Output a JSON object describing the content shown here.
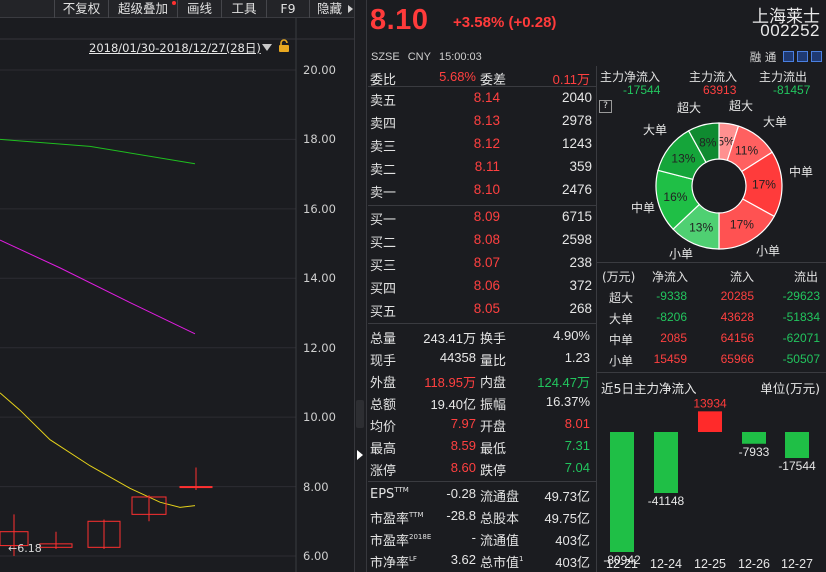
{
  "toolbar": {
    "items": [
      {
        "label": "不复权",
        "dot": false,
        "arrow": false
      },
      {
        "label": "超级叠加",
        "dot": true,
        "arrow": false
      },
      {
        "label": "画线",
        "dot": false,
        "arrow": false
      },
      {
        "label": "工具",
        "dot": false,
        "arrow": false
      },
      {
        "label": "F9",
        "dot": false,
        "arrow": false
      },
      {
        "label": "隐藏",
        "dot": false,
        "arrow": true
      }
    ]
  },
  "chart": {
    "date_range": "2018/01/30-2018/12/27(28日)",
    "y_ticks": [
      "20.00",
      "18.00",
      "16.00",
      "14.00",
      "12.00",
      "10.00",
      "8.00",
      "6.00"
    ],
    "price_marker": "←6.18",
    "colors": {
      "ma_green": "#1fbf1f",
      "ma_magenta": "#e01ce0",
      "ma_yellow": "#e6d21a",
      "candle_up": "#ff3030"
    }
  },
  "quote": {
    "price": "8.10",
    "change": "+3.58% (+0.28)",
    "name": "上海莱士",
    "code": "002252",
    "exchange": "SZSE",
    "currency": "CNY",
    "time": "15:00:03",
    "badges": "融 通"
  },
  "orderbook": {
    "weibi": {
      "label": "委比",
      "value": "5.68%"
    },
    "weicha": {
      "label": "委差",
      "value": "0.11万"
    },
    "asks": [
      {
        "label": "卖五",
        "price": "8.14",
        "vol": "2040"
      },
      {
        "label": "卖四",
        "price": "8.13",
        "vol": "2978"
      },
      {
        "label": "卖三",
        "price": "8.12",
        "vol": "1243"
      },
      {
        "label": "卖二",
        "price": "8.11",
        "vol": "359"
      },
      {
        "label": "卖一",
        "price": "8.10",
        "vol": "2476"
      }
    ],
    "bids": [
      {
        "label": "买一",
        "price": "8.09",
        "vol": "6715"
      },
      {
        "label": "买二",
        "price": "8.08",
        "vol": "2598"
      },
      {
        "label": "买三",
        "price": "8.07",
        "vol": "238"
      },
      {
        "label": "买四",
        "price": "8.06",
        "vol": "372"
      },
      {
        "label": "买五",
        "price": "8.05",
        "vol": "268"
      }
    ],
    "stats": [
      {
        "k1": "总量",
        "v1": "243.41万",
        "c1": "white",
        "k2": "换手",
        "v2": "4.90%",
        "c2": "white"
      },
      {
        "k1": "现手",
        "v1": "44358",
        "c1": "white",
        "k2": "量比",
        "v2": "1.23",
        "c2": "white"
      },
      {
        "k1": "外盘",
        "v1": "118.95万",
        "c1": "red",
        "k2": "内盘",
        "v2": "124.47万",
        "c2": "green"
      },
      {
        "k1": "总额",
        "v1": "19.40亿",
        "c1": "white",
        "k2": "振幅",
        "v2": "16.37%",
        "c2": "white"
      },
      {
        "k1": "均价",
        "v1": "7.97",
        "c1": "red",
        "k2": "开盘",
        "v2": "8.01",
        "c2": "red"
      },
      {
        "k1": "最高",
        "v1": "8.59",
        "c1": "red",
        "k2": "最低",
        "v2": "7.31",
        "c2": "green"
      },
      {
        "k1": "涨停",
        "v1": "8.60",
        "c1": "red",
        "k2": "跌停",
        "v2": "7.04",
        "c2": "green"
      }
    ],
    "fundamentals": [
      {
        "k1": "EPS",
        "s1": "TTM",
        "v1": "-0.28",
        "k2": "流通盘",
        "v2": "49.73亿"
      },
      {
        "k1": "市盈率",
        "s1": "TTM",
        "v1": "-28.8",
        "k2": "总股本",
        "v2": "49.75亿"
      },
      {
        "k1": "市盈率",
        "s1": "2018E",
        "v1": "-",
        "k2": "流通值",
        "v2": "403亿"
      },
      {
        "k1": "市净率",
        "s1": "LF",
        "v1": "3.62",
        "k2": "总市值",
        "s2": "1",
        "v2": "403亿"
      }
    ]
  },
  "fundflow": {
    "headers": [
      "主力净流入",
      "主力流入",
      "主力流出"
    ],
    "values": [
      "-17544",
      "63913",
      "-81457"
    ],
    "help": "?",
    "donut": {
      "slices": [
        {
          "label": "超大",
          "pct": "5%",
          "value": 5,
          "color": "#ff9090"
        },
        {
          "label": "大单",
          "pct": "11%",
          "value": 11,
          "color": "#ff6060"
        },
        {
          "label": "中单",
          "pct": "17%",
          "value": 17,
          "color": "#ff3b3b"
        },
        {
          "label": "小单",
          "pct": "17%",
          "value": 17,
          "color": "#ff5252"
        },
        {
          "label": "小单",
          "pct": "13%",
          "value": 13,
          "color": "#4fd072"
        },
        {
          "label": "中单",
          "pct": "16%",
          "value": 16,
          "color": "#1fbf46"
        },
        {
          "label": "大单",
          "pct": "13%",
          "value": 13,
          "color": "#15a53a"
        },
        {
          "label": "超大",
          "pct": "8%",
          "value": 8,
          "color": "#0f8a30"
        }
      ],
      "outer_labels": [
        "超大",
        "大单",
        "中单",
        "小单",
        "小单",
        "中单",
        "大单",
        "超大"
      ]
    },
    "table": {
      "headers": [
        "(万元)",
        "净流入",
        "流入",
        "流出"
      ],
      "rows": [
        {
          "label": "超大",
          "net": "-9338",
          "in": "20285",
          "out": "-29623"
        },
        {
          "label": "大单",
          "net": "-8206",
          "in": "43628",
          "out": "-51834"
        },
        {
          "label": "中单",
          "net": "2085",
          "in": "64156",
          "out": "-62071"
        },
        {
          "label": "小单",
          "net": "15459",
          "in": "65966",
          "out": "-50507"
        }
      ]
    },
    "bars": {
      "title": "近5日主力净流入",
      "unit": "单位(万元)",
      "days": [
        {
          "date": "12-21",
          "value": -80942,
          "label": "-80942"
        },
        {
          "date": "12-24",
          "value": -41148,
          "label": "-41148"
        },
        {
          "date": "12-25",
          "value": 13934,
          "label": "13934"
        },
        {
          "date": "12-26",
          "value": -7933,
          "label": "-7933"
        },
        {
          "date": "12-27",
          "value": -17544,
          "label": "-17544"
        }
      ]
    }
  }
}
